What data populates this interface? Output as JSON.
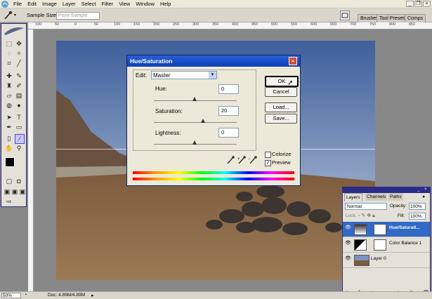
{
  "menu": {
    "items": [
      "File",
      "Edit",
      "Image",
      "Layer",
      "Select",
      "Filter",
      "View",
      "Window",
      "Help"
    ]
  },
  "options": {
    "sample_size_label": "Sample Size:",
    "sample_size_value": "Point Sample"
  },
  "well": {
    "tabs": [
      "Brushes",
      "Tool Presets",
      "Comps"
    ]
  },
  "ruler": {
    "ticks": [
      "100",
      "50",
      "0",
      "50",
      "100",
      "150",
      "200",
      "250",
      "300",
      "350",
      "400",
      "450",
      "500",
      "550",
      "600",
      "650",
      "700",
      "750",
      "800",
      "850"
    ]
  },
  "dialog": {
    "title": "Hue/Saturation",
    "edit_label": "Edit:",
    "edit_value": "Master",
    "hue_label": "Hue:",
    "hue_value": "0",
    "saturation_label": "Saturation:",
    "saturation_value": "20",
    "lightness_label": "Lightness:",
    "lightness_value": "0",
    "ok": "OK",
    "cancel": "Cancel",
    "load": "Load...",
    "save": "Save...",
    "colorize_label": "Colorize",
    "colorize_checked": false,
    "preview_label": "Preview",
    "preview_checked": true
  },
  "layers_panel": {
    "tabs": [
      "Layers",
      "Channels",
      "Paths"
    ],
    "blend_mode": "Normal",
    "opacity_label": "Opacity:",
    "opacity_value": "100%",
    "lock_label": "Lock:",
    "fill_label": "Fill:",
    "fill_value": "100%",
    "layers": [
      {
        "name": "Hue/Saturati...",
        "selected": true
      },
      {
        "name": "Color Balance 1",
        "selected": false
      },
      {
        "name": "Layer 0",
        "selected": false
      }
    ]
  },
  "status": {
    "zoom": "50%",
    "doc": "Doc: 4.89M/4.89M"
  },
  "colors": {
    "accent": "#0a3fb8",
    "selected_layer": "#3169C6"
  }
}
